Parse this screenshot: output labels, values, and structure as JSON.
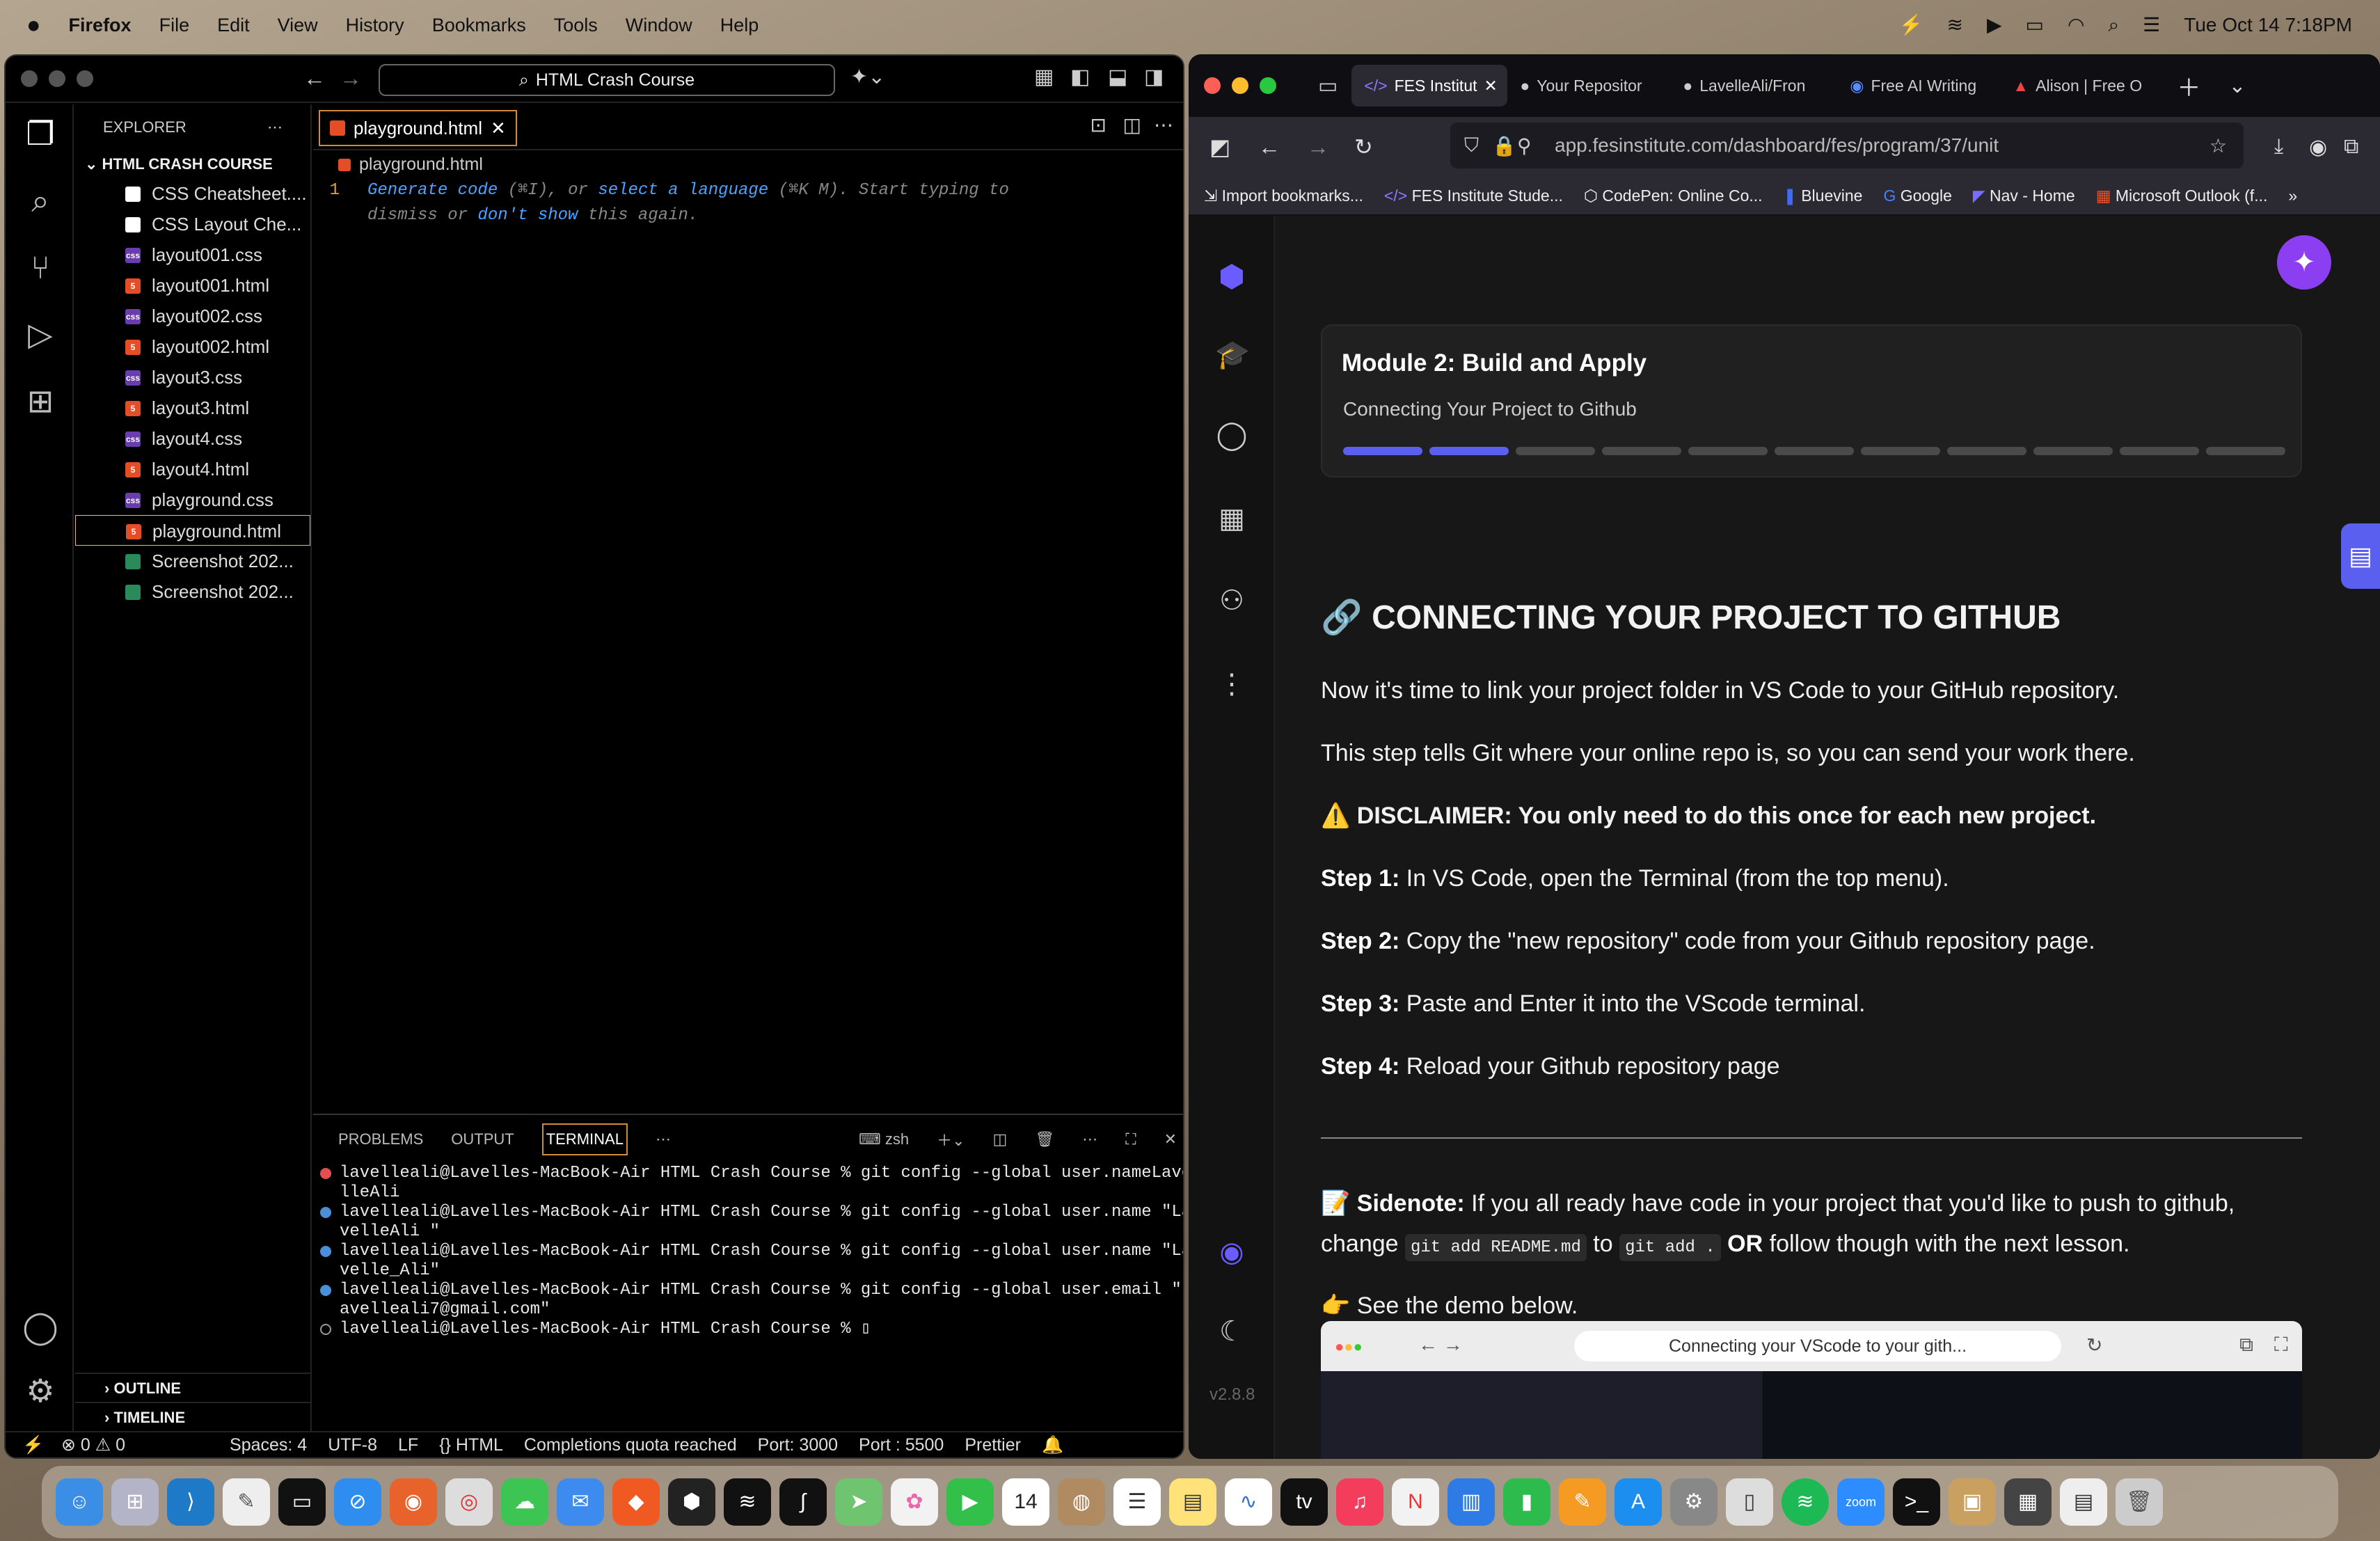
{
  "menubar": {
    "apple": "",
    "app": "Firefox",
    "items": [
      "File",
      "Edit",
      "View",
      "History",
      "Bookmarks",
      "Tools",
      "Window",
      "Help"
    ],
    "clock": "Tue Oct 14  7:18PM"
  },
  "vscode": {
    "search": "HTML Crash Course",
    "explorer_label": "EXPLORER",
    "folder": "HTML CRASH COURSE",
    "files": [
      {
        "name": "CSS Cheatsheet....",
        "type": "pdf"
      },
      {
        "name": "CSS Layout Che...",
        "type": "pdf"
      },
      {
        "name": "layout001.css",
        "type": "css"
      },
      {
        "name": "layout001.html",
        "type": "html"
      },
      {
        "name": "layout002.css",
        "type": "css"
      },
      {
        "name": "layout002.html",
        "type": "html"
      },
      {
        "name": "layout3.css",
        "type": "css"
      },
      {
        "name": "layout3.html",
        "type": "html"
      },
      {
        "name": "layout4.css",
        "type": "css"
      },
      {
        "name": "layout4.html",
        "type": "html"
      },
      {
        "name": "playground.css",
        "type": "css"
      },
      {
        "name": "playground.html",
        "type": "html",
        "selected": true
      },
      {
        "name": "Screenshot 202...",
        "type": "img"
      },
      {
        "name": "Screenshot 202...",
        "type": "img"
      }
    ],
    "outline": "OUTLINE",
    "timeline": "TIMELINE",
    "tab": "playground.html",
    "breadcrumb": "playground.html",
    "line_number": "1",
    "hint": {
      "a": "Generate code",
      "b": " (⌘I), or ",
      "c": "select a language",
      "d": " (⌘K M). Start typing to",
      "e": "dismiss or ",
      "f": "don't show",
      "g": " this again."
    },
    "panel_tabs": [
      "PROBLEMS",
      "OUTPUT",
      "TERMINAL"
    ],
    "shell": "zsh",
    "terminal": [
      {
        "status": "error",
        "text": "lavelleali@Lavelles-MacBook-Air HTML Crash Course % git config --global user.nameLave\nlleAli"
      },
      {
        "status": "ok",
        "text": "lavelleali@Lavelles-MacBook-Air HTML Crash Course % git config --global user.name \"La\nvelleAli \""
      },
      {
        "status": "ok",
        "text": "lavelleali@Lavelles-MacBook-Air HTML Crash Course % git config --global user.name \"La\nvelle_Ali\""
      },
      {
        "status": "ok",
        "text": "lavelleali@Lavelles-MacBook-Air HTML Crash Course % git config --global user.email \"l\navelleali7@gmail.com\""
      },
      {
        "status": "idle",
        "text": "lavelleali@Lavelles-MacBook-Air HTML Crash Course % ▯"
      }
    ],
    "status": [
      "⊗ 0 ⚠ 0",
      "Spaces: 4",
      "UTF-8",
      "LF",
      "{} HTML",
      "Completions quota reached",
      "Port: 3000",
      "Port : 5500",
      "Prettier"
    ]
  },
  "firefox": {
    "tabs": [
      "FES Institut",
      "Your Repositor",
      "LavelleAli/Fron",
      "Free AI Writing",
      "Alison | Free O"
    ],
    "url": "app.fesinstitute.com/dashboard/fes/program/37/unit",
    "bookmarks": [
      "Import bookmarks...",
      "FES Institute Stude...",
      "CodePen: Online Co...",
      "Bluevine",
      "Google",
      "Nav - Home",
      "Microsoft Outlook (f..."
    ],
    "version": "v2.8.8"
  },
  "page": {
    "module_title": "Module 2: Build and Apply",
    "module_sub": "Connecting Your Project to Github",
    "progress": {
      "completed": 2,
      "total": 11
    },
    "heading": "🔗 CONNECTING YOUR PROJECT TO GITHUB",
    "p1": "Now it's time to link your project folder in VS Code to your GitHub repository.",
    "p2": "This step tells Git where your online repo is, so you can send your work there.",
    "disclaimer": "⚠️ DISCLAIMER: You only need to do this once for each new project.",
    "steps": [
      {
        "label": "Step 1:",
        "text": " In VS Code, open the Terminal (from the top menu)."
      },
      {
        "label": "Step 2:",
        "text": " Copy the \"new repository\" code from your Github repository page."
      },
      {
        "label": "Step 3:",
        "text": " Paste and Enter it into the VScode terminal."
      },
      {
        "label": "Step 4:",
        "text": " Reload your Github repository page"
      }
    ],
    "sidenote_label": "📝 Sidenote:",
    "sidenote_a": " If you all ready have code in your project that you'd like to push to github, change ",
    "code1": "git add README.md",
    "sidenote_b": " to ",
    "code2": "git add .",
    "sidenote_or": " OR",
    "sidenote_c": " follow though with the next lesson.",
    "demo_line": "👉 See the demo below.",
    "demo_url": "Connecting your VScode to your gith..."
  }
}
